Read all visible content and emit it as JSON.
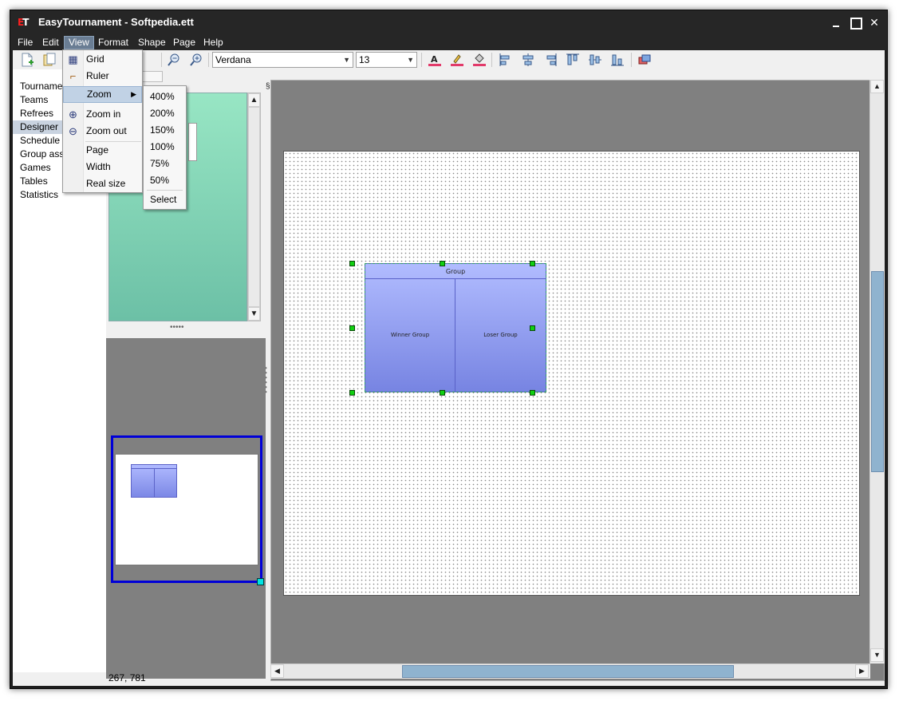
{
  "window": {
    "title": "EasyTournament - Softpedia.ett",
    "icon": "easytournament-logo",
    "min_glyph": "",
    "max_glyph": "",
    "close_glyph": "✕"
  },
  "menubar": {
    "items": [
      "File",
      "Edit",
      "View",
      "Format",
      "Shape",
      "Page",
      "Help"
    ],
    "active": "View"
  },
  "toolbar": {
    "font_family": "Verdana",
    "font_size": "13",
    "icons": [
      "new-document-icon",
      "open-document-icon",
      "zoom-out-icon",
      "zoom-in-icon",
      "font-color-icon",
      "line-color-icon",
      "fill-color-icon",
      "align-left-icon",
      "align-center-icon",
      "align-right-icon",
      "align-top-icon",
      "align-middle-icon",
      "align-bottom-icon",
      "bring-to-front-icon"
    ]
  },
  "nav": {
    "items": [
      "Tournament",
      "Teams",
      "Refrees",
      "Designer",
      "Schedule",
      "Group assi",
      "Games",
      "Tables",
      "Statistics"
    ],
    "selected": "Designer"
  },
  "view_menu": {
    "items": [
      {
        "label": "Grid",
        "icon": "grid-icon"
      },
      {
        "label": "Ruler",
        "icon": "ruler-icon"
      },
      {
        "label": "Zoom",
        "icon": "",
        "has_submenu": true,
        "highlighted": true
      },
      {
        "label": "Zoom in",
        "icon": "zoom-in-icon"
      },
      {
        "label": "Zoom out",
        "icon": "zoom-out-icon"
      },
      {
        "label": "Page",
        "icon": ""
      },
      {
        "label": "Width",
        "icon": ""
      },
      {
        "label": "Real size",
        "icon": ""
      }
    ]
  },
  "zoom_submenu": {
    "items": [
      "400%",
      "200%",
      "150%",
      "100%",
      "75%",
      "50%",
      "Select"
    ]
  },
  "designer": {
    "group_shape": {
      "title": "Group",
      "left_cell": "Winner Group",
      "right_cell": "Loser Group"
    }
  },
  "status": {
    "cursor_position": "267, 781"
  },
  "colors": {
    "selection_handle": "#10d010",
    "group_fill_top": "#b1bcff",
    "group_fill_bottom": "#7784e2",
    "overview_frame": "#0000d8",
    "palette_fill": "#98e6c4"
  }
}
